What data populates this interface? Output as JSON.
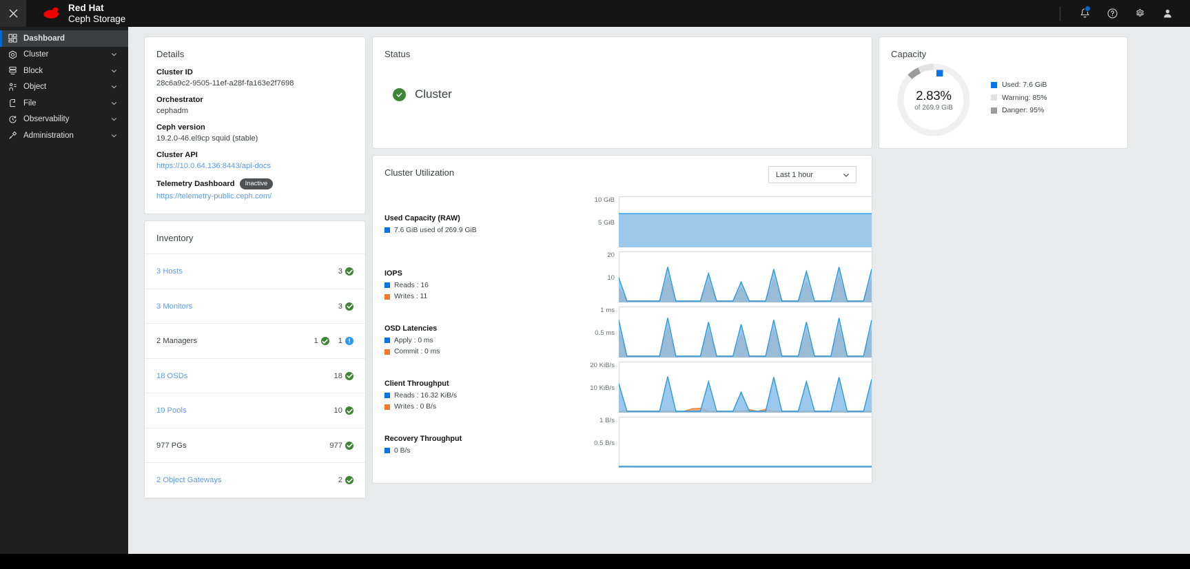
{
  "header": {
    "close_icon": "close-icon",
    "brand_line1": "Red Hat",
    "brand_line2": "Ceph Storage",
    "icons": [
      {
        "name": "notification-bell-icon",
        "label": "Notifications"
      },
      {
        "name": "help-icon",
        "label": "Help"
      },
      {
        "name": "gear-icon",
        "label": "Settings"
      },
      {
        "name": "user-avatar-icon",
        "label": "User"
      }
    ]
  },
  "sidebar": {
    "items": [
      {
        "label": "Dashboard",
        "icon": "dashboard-icon",
        "active": true,
        "expandable": false
      },
      {
        "label": "Cluster",
        "icon": "cluster-icon",
        "active": false,
        "expandable": true
      },
      {
        "label": "Block",
        "icon": "block-icon",
        "active": false,
        "expandable": true
      },
      {
        "label": "Object",
        "icon": "object-icon",
        "active": false,
        "expandable": true
      },
      {
        "label": "File",
        "icon": "file-icon",
        "active": false,
        "expandable": true
      },
      {
        "label": "Observability",
        "icon": "observability-icon",
        "active": false,
        "expandable": true
      },
      {
        "label": "Administration",
        "icon": "administration-icon",
        "active": false,
        "expandable": true
      }
    ]
  },
  "details": {
    "title": "Details",
    "cluster_id_label": "Cluster ID",
    "cluster_id_value": "28c6a9c2-9505-11ef-a28f-fa163e2f7698",
    "orchestrator_label": "Orchestrator",
    "orchestrator_value": "cephadm",
    "ceph_version_label": "Ceph version",
    "ceph_version_value": "19.2.0-46.el9cp squid (stable)",
    "cluster_api_label": "Cluster API",
    "cluster_api_value": "https://10.0.64.136:8443/api-docs",
    "telemetry_label": "Telemetry Dashboard",
    "telemetry_badge": "Inactive",
    "telemetry_link": "https://telemetry-public.ceph.com/"
  },
  "inventory": {
    "title": "Inventory",
    "rows": [
      {
        "label": "3 Hosts",
        "link": true,
        "counts": [
          {
            "value": "3",
            "status": "ok"
          }
        ]
      },
      {
        "label": "3 Monitors",
        "link": true,
        "counts": [
          {
            "value": "3",
            "status": "ok"
          }
        ]
      },
      {
        "label": "2 Managers",
        "link": false,
        "counts": [
          {
            "value": "1",
            "status": "ok"
          },
          {
            "value": "1",
            "status": "info"
          }
        ]
      },
      {
        "label": "18 OSDs",
        "link": true,
        "counts": [
          {
            "value": "18",
            "status": "ok"
          }
        ]
      },
      {
        "label": "10 Pools",
        "link": true,
        "counts": [
          {
            "value": "10",
            "status": "ok"
          }
        ]
      },
      {
        "label": "977 PGs",
        "link": false,
        "counts": [
          {
            "value": "977",
            "status": "ok"
          }
        ]
      },
      {
        "label": "2 Object Gateways",
        "link": true,
        "counts": [
          {
            "value": "2",
            "status": "ok"
          }
        ]
      }
    ]
  },
  "status": {
    "title": "Status",
    "cluster_label": "Cluster",
    "cluster_state": "ok"
  },
  "capacity": {
    "title": "Capacity",
    "percent_text": "2.83%",
    "of_text": "of 269.9 GiB",
    "legend": [
      {
        "label": "Used: 7.6 GiB",
        "color": "#0b74e5"
      },
      {
        "label": "Warning: 85%",
        "color": "#e3e3e3"
      },
      {
        "label": "Danger: 95%",
        "color": "#9b9b9b"
      }
    ]
  },
  "cluster_utilization": {
    "title": "Cluster Utilization",
    "time_range": "Last 1 hour",
    "chevron_icon": "chevron-down-icon",
    "metrics": [
      {
        "name": "Used Capacity (RAW)",
        "legend": [
          {
            "label": "7.6 GiB used of 269.9 GiB",
            "color": "#0b74e5"
          }
        ],
        "axis": [
          "10 GiB",
          "5 GiB"
        ]
      },
      {
        "name": "IOPS",
        "legend": [
          {
            "label": "Reads : 16",
            "color": "#0b74e5"
          },
          {
            "label": "Writes : 11",
            "color": "#f4772a"
          }
        ],
        "axis": [
          "20",
          "10"
        ]
      },
      {
        "name": "OSD Latencies",
        "legend": [
          {
            "label": "Apply : 0 ms",
            "color": "#0b74e5"
          },
          {
            "label": "Commit : 0 ms",
            "color": "#f4772a"
          }
        ],
        "axis": [
          "1 ms",
          "0.5 ms"
        ]
      },
      {
        "name": "Client Throughput",
        "legend": [
          {
            "label": "Reads : 16.32 KiB/s",
            "color": "#0b74e5"
          },
          {
            "label": "Writes : 0 B/s",
            "color": "#f4772a"
          }
        ],
        "axis": [
          "20 KiB/s",
          "10 KiB/s"
        ]
      },
      {
        "name": "Recovery Throughput",
        "legend": [
          {
            "label": "0 B/s",
            "color": "#0b74e5"
          }
        ],
        "axis": [
          "1 B/s",
          "0.5 B/s"
        ]
      }
    ]
  },
  "chart_data": [
    {
      "type": "area",
      "title": "Used Capacity (RAW)",
      "ylabel": "GiB",
      "yticks": [
        10,
        5
      ],
      "ylim": [
        0,
        11
      ],
      "series": [
        {
          "name": "Used Capacity",
          "color": "#0b74e5",
          "values": [
            7.6,
            7.6,
            7.6,
            7.6,
            7.6,
            7.6,
            7.6,
            7.6,
            7.6,
            7.6,
            7.6,
            7.6,
            7.6,
            7.6,
            7.6,
            7.6,
            7.6,
            7.6,
            7.6,
            7.6
          ]
        }
      ]
    },
    {
      "type": "area",
      "title": "IOPS",
      "ylabel": "ops",
      "yticks": [
        20,
        10
      ],
      "ylim": [
        0,
        22
      ],
      "series": [
        {
          "name": "Reads",
          "color": "#0b74e5",
          "values": [
            11,
            0,
            0,
            0,
            0,
            0,
            16,
            0,
            0,
            0,
            0,
            13,
            0,
            0,
            0,
            9,
            0,
            0,
            0,
            15,
            0,
            0,
            0,
            14,
            0,
            0,
            0,
            16,
            0,
            0,
            0,
            15
          ]
        },
        {
          "name": "Writes",
          "color": "#f4772a",
          "values": [
            6,
            0,
            0,
            0,
            0,
            0,
            11,
            0,
            0,
            0,
            0,
            9,
            0,
            0,
            0,
            6,
            0,
            0,
            0,
            10,
            0,
            0,
            0,
            9,
            0,
            0,
            0,
            11,
            0,
            0,
            0,
            10
          ]
        }
      ]
    },
    {
      "type": "area",
      "title": "OSD Latencies",
      "ylabel": "ms",
      "yticks": [
        1,
        0.5
      ],
      "ylim": [
        0,
        1.1
      ],
      "series": [
        {
          "name": "Apply",
          "color": "#0b74e5",
          "values": [
            0.85,
            0,
            0,
            0,
            0,
            0,
            0.9,
            0,
            0,
            0,
            0,
            0.8,
            0,
            0,
            0,
            0.75,
            0,
            0,
            0,
            0.85,
            0,
            0,
            0,
            0.8,
            0,
            0,
            0,
            0.9,
            0,
            0,
            0,
            0.85
          ]
        },
        {
          "name": "Commit",
          "color": "#f4772a",
          "values": [
            0.6,
            0,
            0,
            0,
            0,
            0,
            0.65,
            0,
            0,
            0,
            0,
            0.58,
            0,
            0,
            0,
            0.5,
            0,
            0,
            0,
            0.6,
            0,
            0,
            0,
            0.55,
            0,
            0,
            0,
            0.62,
            0,
            0,
            0,
            0.6
          ]
        }
      ]
    },
    {
      "type": "area",
      "title": "Client Throughput",
      "ylabel": "KiB/s",
      "yticks": [
        20,
        10
      ],
      "ylim": [
        0,
        22
      ],
      "series": [
        {
          "name": "Reads",
          "color": "#0b74e5",
          "values": [
            13,
            0,
            0,
            0,
            0,
            0,
            16.32,
            0,
            0,
            0,
            0,
            14,
            0,
            0,
            0,
            9,
            0,
            0,
            0,
            16,
            0,
            0,
            0,
            14,
            0,
            0,
            0,
            16,
            0,
            0,
            0,
            15
          ]
        },
        {
          "name": "Writes",
          "color": "#f4772a",
          "values": [
            0,
            0,
            0,
            0,
            0,
            0,
            0,
            0,
            0,
            1.2,
            1.4,
            0,
            0,
            0,
            0,
            0,
            0.8,
            0,
            0.9,
            0,
            0,
            0,
            0,
            0,
            0,
            0,
            0,
            0,
            0,
            0,
            0,
            0
          ]
        }
      ]
    },
    {
      "type": "area",
      "title": "Recovery Throughput",
      "ylabel": "B/s",
      "yticks": [
        1,
        0.5
      ],
      "ylim": [
        0,
        1.1
      ],
      "series": [
        {
          "name": "Recovery",
          "color": "#0b74e5",
          "values": [
            0,
            0,
            0,
            0,
            0,
            0,
            0,
            0,
            0,
            0,
            0,
            0,
            0,
            0,
            0,
            0,
            0,
            0,
            0,
            0
          ]
        }
      ]
    }
  ]
}
